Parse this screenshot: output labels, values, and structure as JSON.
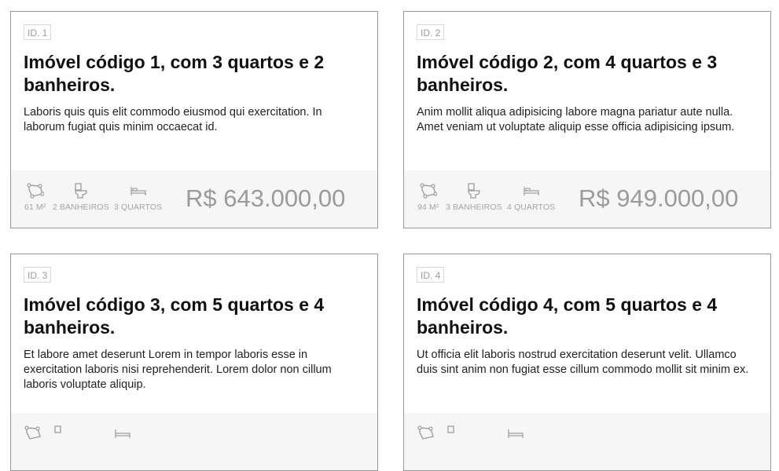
{
  "listings": [
    {
      "id_label": "ID. 1",
      "title": "Imóvel código 1, com 3 quartos e 2 banheiros.",
      "description": "Laboris quis quis elit commodo eiusmod qui exercitation. In laborum fugiat quis minim occaecat id.",
      "area": "61 M²",
      "bathrooms": "2 BANHEIROS",
      "bedrooms": "3 QUARTOS",
      "price": "R$ 643.000,00"
    },
    {
      "id_label": "ID. 2",
      "title": "Imóvel código 2, com 4 quartos e 3 banheiros.",
      "description": "Anim mollit aliqua adipisicing labore magna pariatur aute nulla. Amet veniam ut voluptate aliquip esse officia adipisicing ipsum.",
      "area": "94 M²",
      "bathrooms": "3 BANHEIROS",
      "bedrooms": "4 QUARTOS",
      "price": "R$ 949.000,00"
    },
    {
      "id_label": "ID. 3",
      "title": "Imóvel código 3, com 5 quartos e 4 banheiros.",
      "description": "Et labore amet deserunt Lorem in tempor laboris esse in exercitation laboris nisi reprehenderit. Lorem dolor non cillum laboris voluptate aliquip."
    },
    {
      "id_label": "ID. 4",
      "title": "Imóvel código 4, com 5 quartos e 4 banheiros.",
      "description": "Ut officia elit laboris nostrud exercitation deserunt velit. Ullamco duis sint anim non fugiat esse cillum commodo mollit sit minim ex."
    }
  ],
  "icons": {
    "area": "area-polygon-icon",
    "bath": "toilet-icon",
    "bed": "bed-icon"
  },
  "colors": {
    "card_border": "#9a9a9a",
    "footer_bg": "#f6f6f6",
    "muted_text": "#a4a4a4",
    "title_text": "#111111"
  }
}
